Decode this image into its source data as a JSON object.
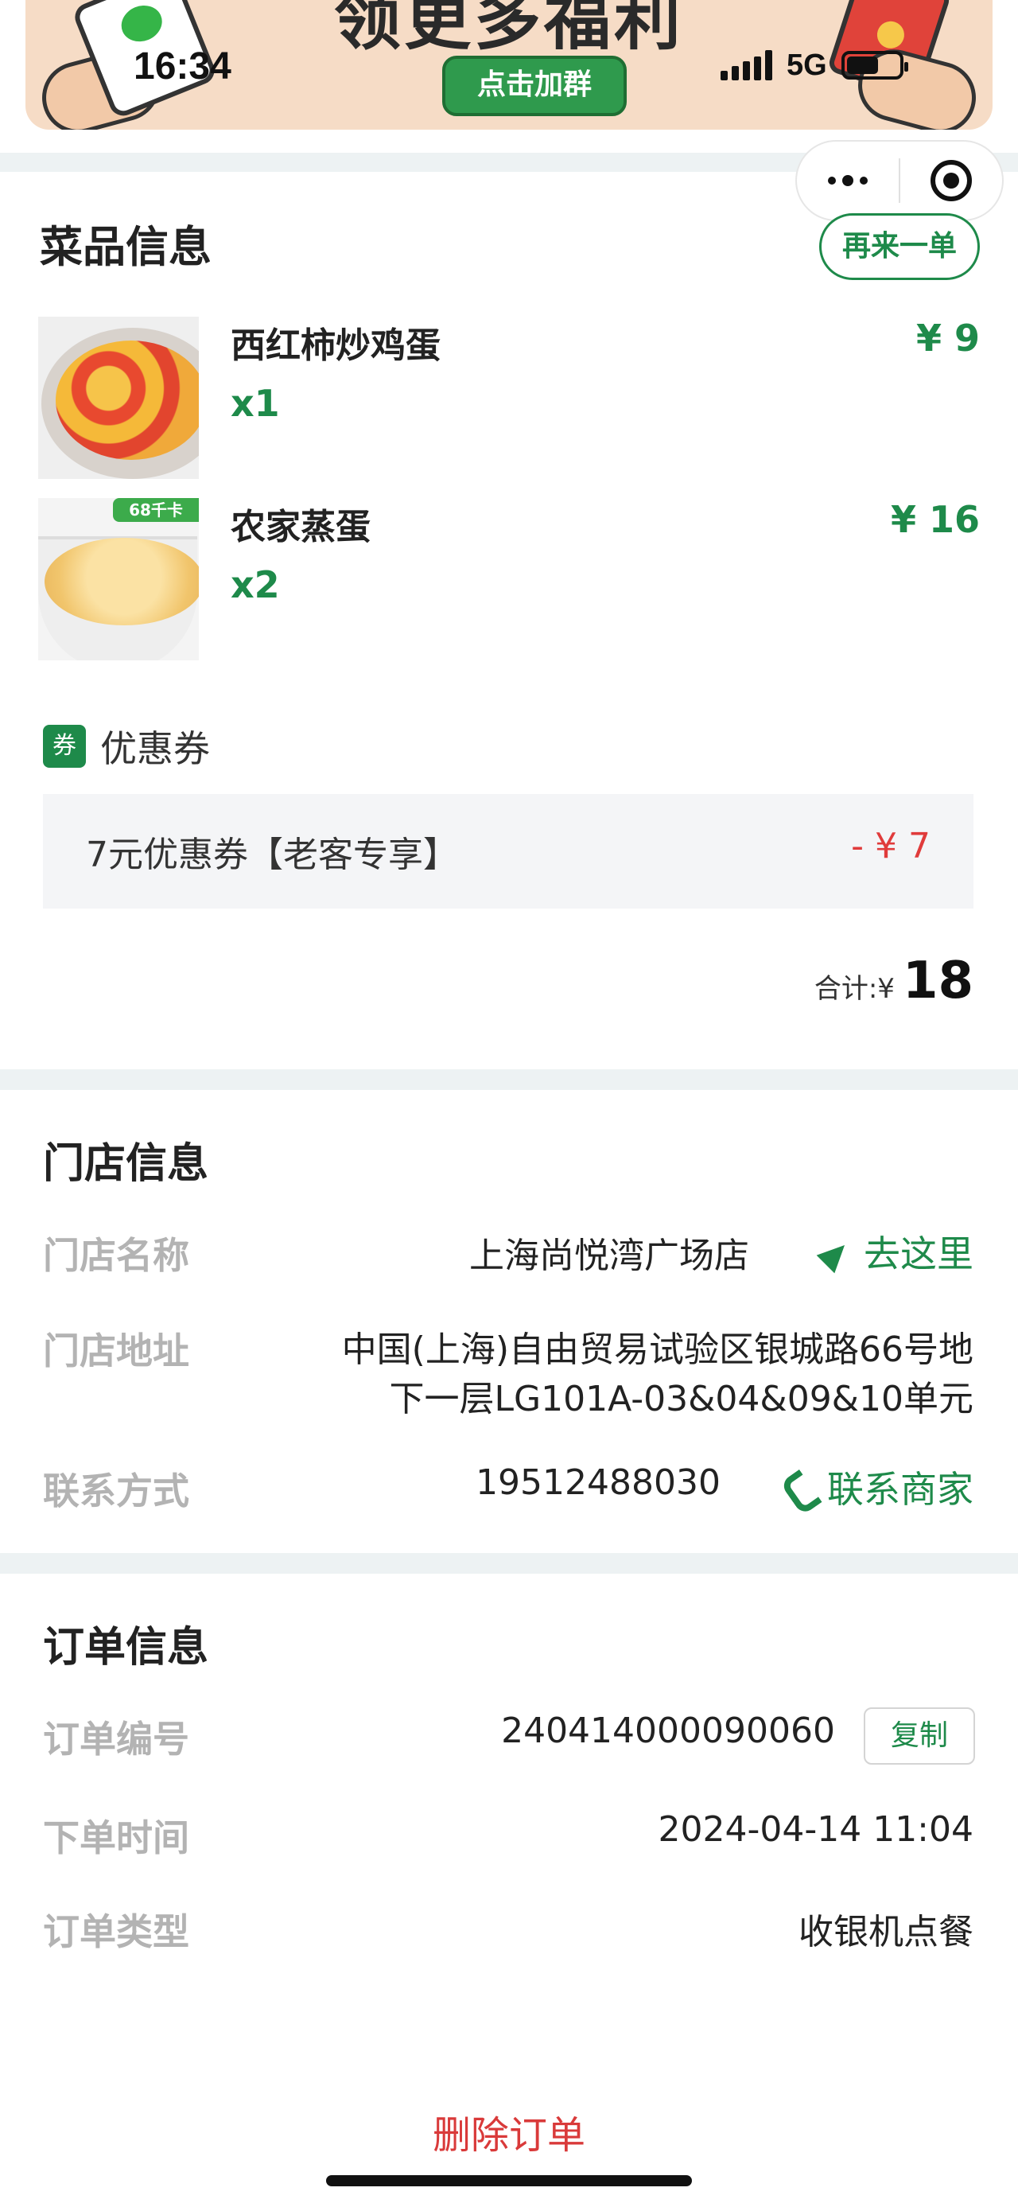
{
  "status_bar": {
    "time": "16:34",
    "network": "5G",
    "battery_level": 0.62,
    "signal_icon": "signal-bars-icon"
  },
  "banner": {
    "title": "领更多福利",
    "button_label": "点击加群"
  },
  "capsule": {
    "more_icon": "more-dots-icon",
    "close_icon": "target-close-icon"
  },
  "dishes_section": {
    "title": "菜品信息",
    "reorder_label": "再来一单",
    "items": [
      {
        "name": "西红柿炒鸡蛋",
        "qty": "x1",
        "price": "¥ 9",
        "image": "tomato-egg-image"
      },
      {
        "name": "农家蒸蛋",
        "qty": "x2",
        "price": "¥ 16",
        "image": "steamed-egg-image",
        "badge": "68千卡"
      }
    ],
    "coupon_header": "优惠券",
    "coupon_tag": "券",
    "coupon": {
      "name": "7元优惠券【老客专享】",
      "amount": "- ¥ 7"
    },
    "total_label": "合计:",
    "total_currency": "¥",
    "total_value": "18"
  },
  "store_section": {
    "title": "门店信息",
    "name_label": "门店名称",
    "name_value": "上海尚悦湾广场店",
    "navigate_label": "去这里",
    "address_label": "门店地址",
    "address_line1": "中国(上海)自由贸易试验区银城路66号地",
    "address_line2": "下一层LG101A-03&04&09&10单元",
    "contact_label": "联系方式",
    "contact_value": "19512488030",
    "call_label": "联系商家"
  },
  "order_section": {
    "title": "订单信息",
    "number_label": "订单编号",
    "number_value": "240414000090060",
    "copy_label": "复制",
    "time_label": "下单时间",
    "time_value": "2024-04-14 11:04",
    "type_label": "订单类型",
    "type_value": "收银机点餐"
  },
  "footer": {
    "delete_label": "删除订单"
  },
  "colors": {
    "accent_green": "#1e8a4a",
    "danger_red": "#d93a3a",
    "separator": "#edf2f3"
  }
}
